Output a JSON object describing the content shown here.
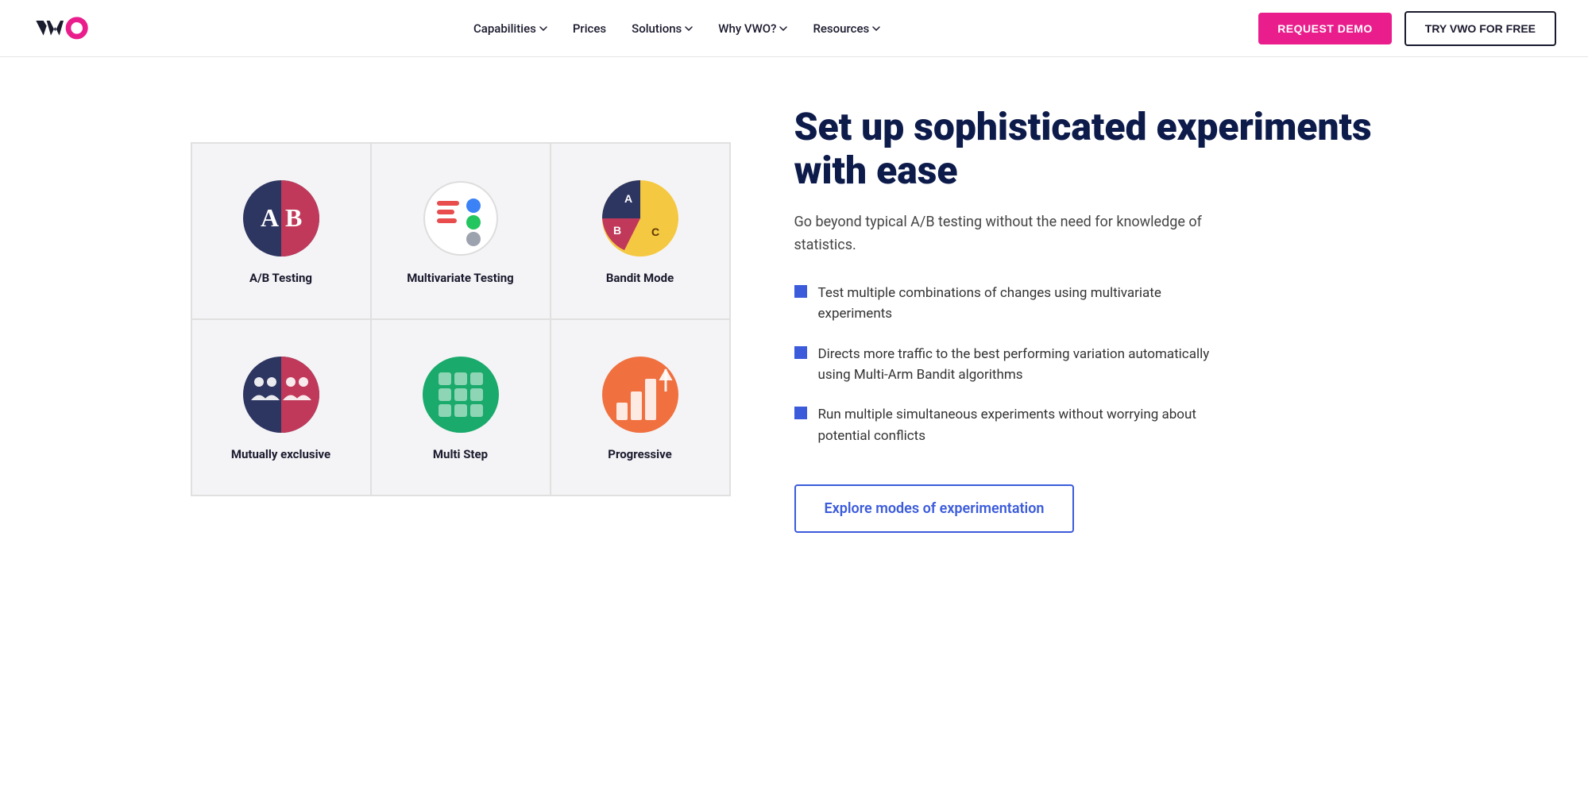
{
  "nav": {
    "logo_text": "VWO",
    "links": [
      {
        "label": "Capabilities",
        "has_dropdown": true
      },
      {
        "label": "Prices",
        "has_dropdown": false
      },
      {
        "label": "Solutions",
        "has_dropdown": true
      },
      {
        "label": "Why VWO?",
        "has_dropdown": true
      },
      {
        "label": "Resources",
        "has_dropdown": true
      }
    ],
    "cta_demo": "REQUEST DEMO",
    "cta_try": "TRY VWO FOR FREE"
  },
  "grid": {
    "cells": [
      {
        "id": "ab-testing",
        "label": "A/B Testing"
      },
      {
        "id": "multivariate",
        "label": "Multivariate Testing"
      },
      {
        "id": "bandit",
        "label": "Bandit Mode"
      },
      {
        "id": "mutually-exclusive",
        "label": "Mutually exclusive"
      },
      {
        "id": "multi-step",
        "label": "Multi Step"
      },
      {
        "id": "progressive",
        "label": "Progressive"
      }
    ]
  },
  "content": {
    "headline": "Set up sophisticated experiments with ease",
    "subtext": "Go beyond typical A/B testing without the need for knowledge of statistics.",
    "bullets": [
      "Test multiple combinations of changes using multivariate experiments",
      "Directs more traffic to the best performing variation automatically using Multi-Arm Bandit algorithms",
      "Run multiple simultaneous experiments without worrying about potential conflicts"
    ],
    "explore_btn": "Explore modes of experimentation"
  }
}
